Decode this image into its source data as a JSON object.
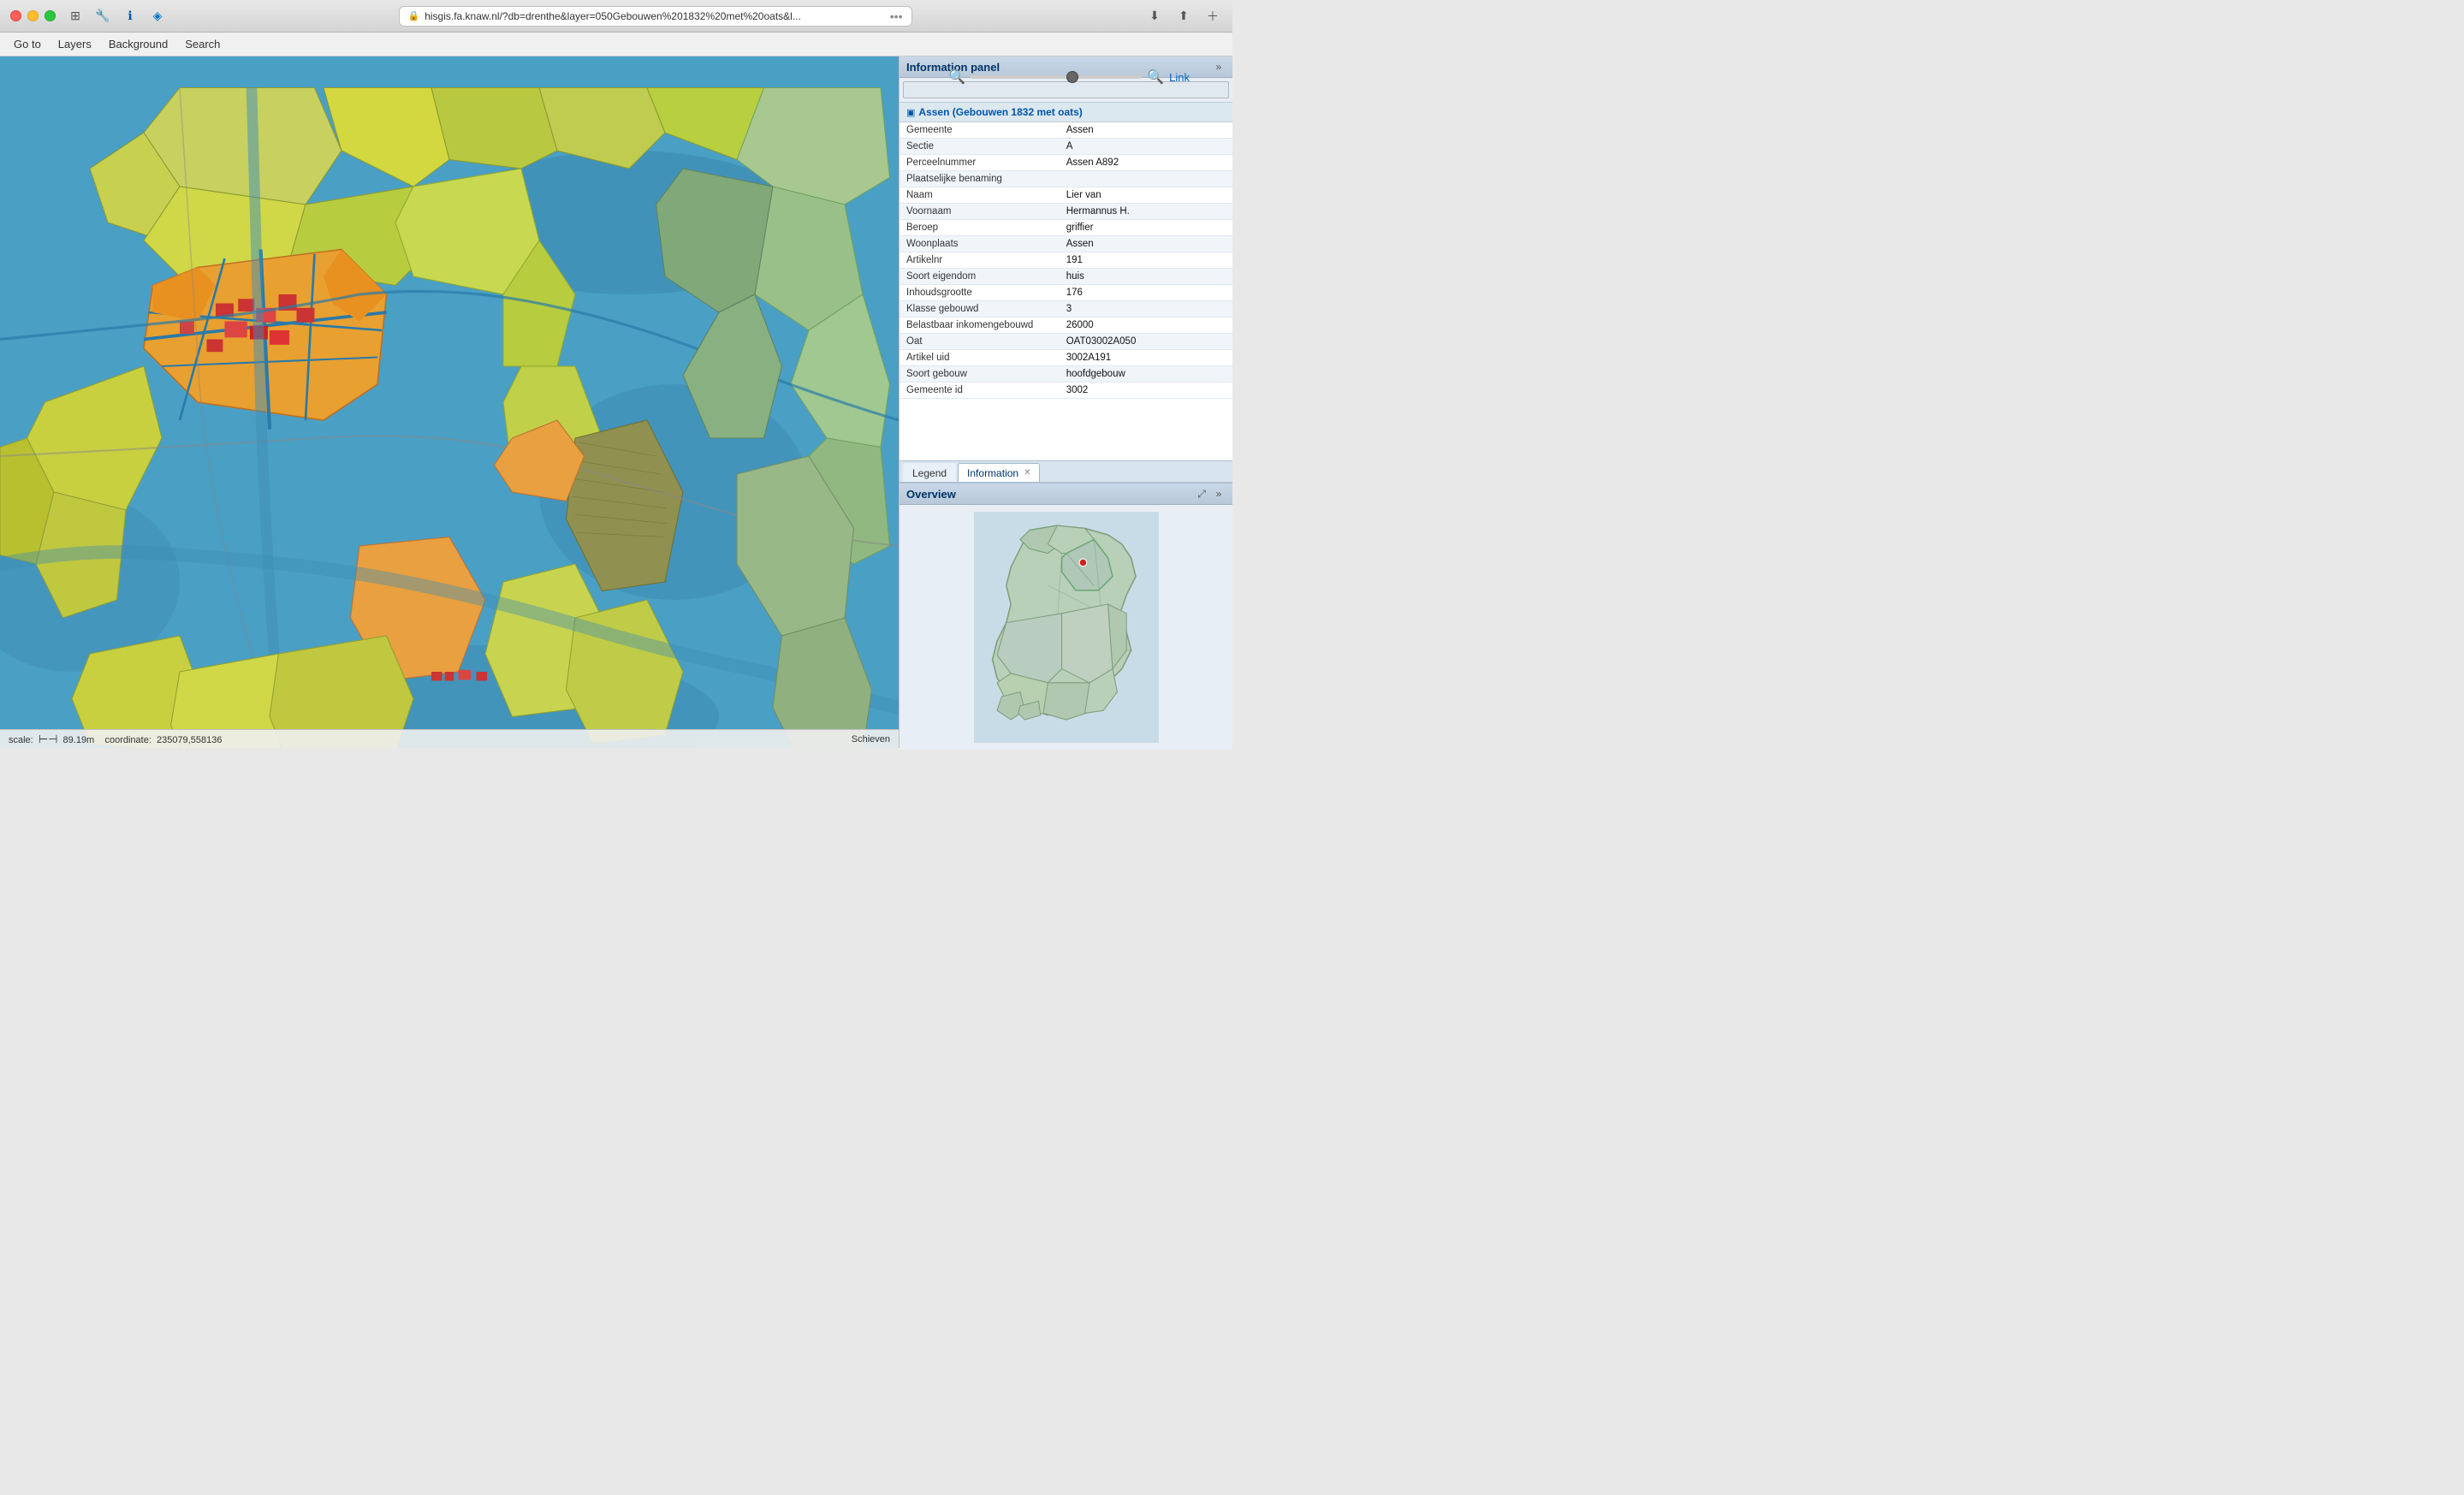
{
  "titlebar": {
    "url": "hisgis.fa.knaw.nl/?db=drenthe&layer=050Gebouwen%201832%20met%20oats&l...",
    "traffic_lights": [
      "red",
      "yellow",
      "green"
    ]
  },
  "menubar": {
    "items": [
      "Go to",
      "Layers",
      "Background",
      "Search"
    ],
    "link_label": "Link"
  },
  "zoom": {
    "slider_value": 60
  },
  "info_panel": {
    "title": "Information panel",
    "search_placeholder": "",
    "layer_title": "Assen (Gebouwen 1832 met oats)",
    "attributes": [
      {
        "label": "Gemeente",
        "value": "Assen"
      },
      {
        "label": "Sectie",
        "value": "A"
      },
      {
        "label": "Perceelnummer",
        "value": "Assen A892"
      },
      {
        "label": "Plaatselijke benaming",
        "value": ""
      },
      {
        "label": "Naam",
        "value": "Lier van"
      },
      {
        "label": "Voornaam",
        "value": "Hermannus H."
      },
      {
        "label": "Beroep",
        "value": "griffier"
      },
      {
        "label": "Woonplaats",
        "value": "Assen"
      },
      {
        "label": "Artikelnr",
        "value": "191"
      },
      {
        "label": "Soort eigendom",
        "value": "huis"
      },
      {
        "label": "Inhoudsgrootte",
        "value": "176"
      },
      {
        "label": "Klasse gebouwd",
        "value": "3"
      },
      {
        "label": "Belastbaar inkomengebouwd",
        "value": "26000"
      },
      {
        "label": "Oat",
        "value": "OAT03002A050"
      },
      {
        "label": "Artikel uid",
        "value": "3002A191"
      },
      {
        "label": "Soort gebouw",
        "value": "hoofdgebouw"
      },
      {
        "label": "Gemeente id",
        "value": "3002"
      }
    ],
    "tabs": [
      {
        "label": "Legend",
        "active": false,
        "closeable": false
      },
      {
        "label": "Information",
        "active": true,
        "closeable": true
      }
    ]
  },
  "overview": {
    "title": "Overview"
  },
  "statusbar": {
    "scale_label": "scale:",
    "scale_value": "89.19m",
    "coordinate_label": "coordinate:",
    "coordinate_value": "235079,558136",
    "location_name": "Schieven"
  }
}
